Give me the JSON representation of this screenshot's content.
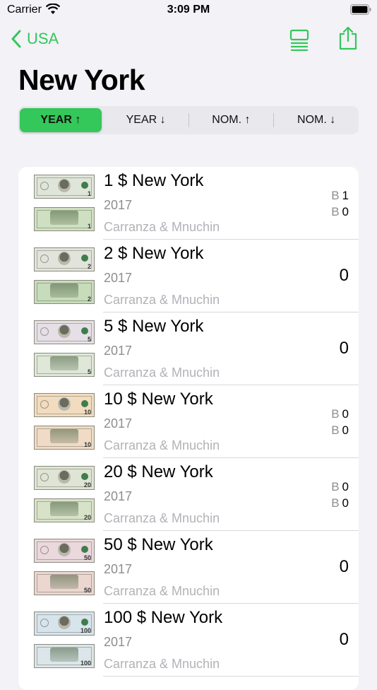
{
  "status_bar": {
    "carrier": "Carrier",
    "time": "3:09 PM"
  },
  "nav": {
    "back_label": "USA"
  },
  "page": {
    "title": "New York"
  },
  "sort_segments": [
    {
      "label": "YEAR ↑",
      "selected": true
    },
    {
      "label": "YEAR ↓",
      "selected": false
    },
    {
      "label": "NOM. ↑",
      "selected": false
    },
    {
      "label": "NOM. ↓",
      "selected": false
    }
  ],
  "colors": {
    "accent": "#34c759",
    "background": "#f2f2f7"
  },
  "notes": [
    {
      "title": "1 $ New York",
      "year": "2017",
      "signers": "Carranza & Mnuchin",
      "count_mode": "split",
      "count_a_label": "B",
      "count_a": "1",
      "count_b_label": "B",
      "count_b": "0",
      "tint": "#dfe6d9",
      "back_tint": "#cfe0c2"
    },
    {
      "title": "2 $ New York",
      "year": "2017",
      "signers": "Carranza & Mnuchin",
      "count_mode": "single",
      "count": "0",
      "tint": "#e2e4dc",
      "back_tint": "#c8dcbc"
    },
    {
      "title": "5 $ New York",
      "year": "2017",
      "signers": "Carranza & Mnuchin",
      "count_mode": "single",
      "count": "0",
      "tint": "#e6e0e6",
      "back_tint": "#dfe8d8"
    },
    {
      "title": "10 $ New York",
      "year": "2017",
      "signers": "Carranza & Mnuchin",
      "count_mode": "split",
      "count_a_label": "B",
      "count_a": "0",
      "count_b_label": "B",
      "count_b": "0",
      "tint": "#f2dcc0",
      "back_tint": "#f0dbc6"
    },
    {
      "title": "20 $ New York",
      "year": "2017",
      "signers": "Carranza & Mnuchin",
      "count_mode": "split",
      "count_a_label": "B",
      "count_a": "0",
      "count_b_label": "B",
      "count_b": "0",
      "tint": "#dfe4d4",
      "back_tint": "#d8e2c8"
    },
    {
      "title": "50 $ New York",
      "year": "2017",
      "signers": "Carranza & Mnuchin",
      "count_mode": "single",
      "count": "0",
      "tint": "#ead8dc",
      "back_tint": "#ecd6d0"
    },
    {
      "title": "100 $ New York",
      "year": "2017",
      "signers": "Carranza & Mnuchin",
      "count_mode": "single",
      "count": "0",
      "tint": "#d8e4ec",
      "back_tint": "#dce6ea"
    }
  ]
}
